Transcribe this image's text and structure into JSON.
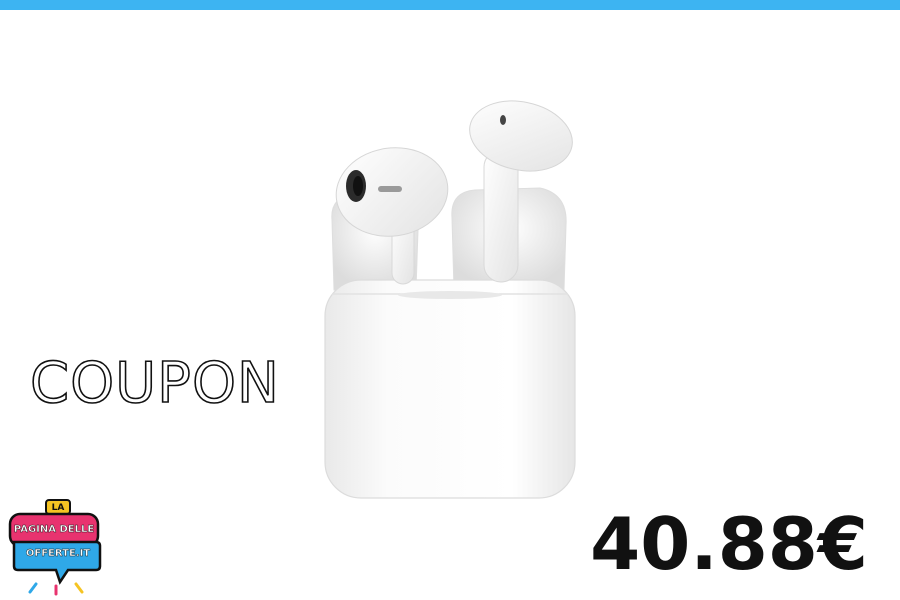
{
  "banner": {
    "accent_color": "#3db4f2",
    "coupon_label": "COUPON",
    "price": "40.88€"
  },
  "product_image": {
    "icon": "wireless-earbuds-case-icon"
  },
  "logo": {
    "line1": "LA",
    "line2": "PAGINA DELLE",
    "line3": "OFFERTE.IT",
    "colors": {
      "pink": "#e8336f",
      "blue": "#2fa8e8",
      "yellow": "#f5c423",
      "dark": "#111111"
    }
  }
}
